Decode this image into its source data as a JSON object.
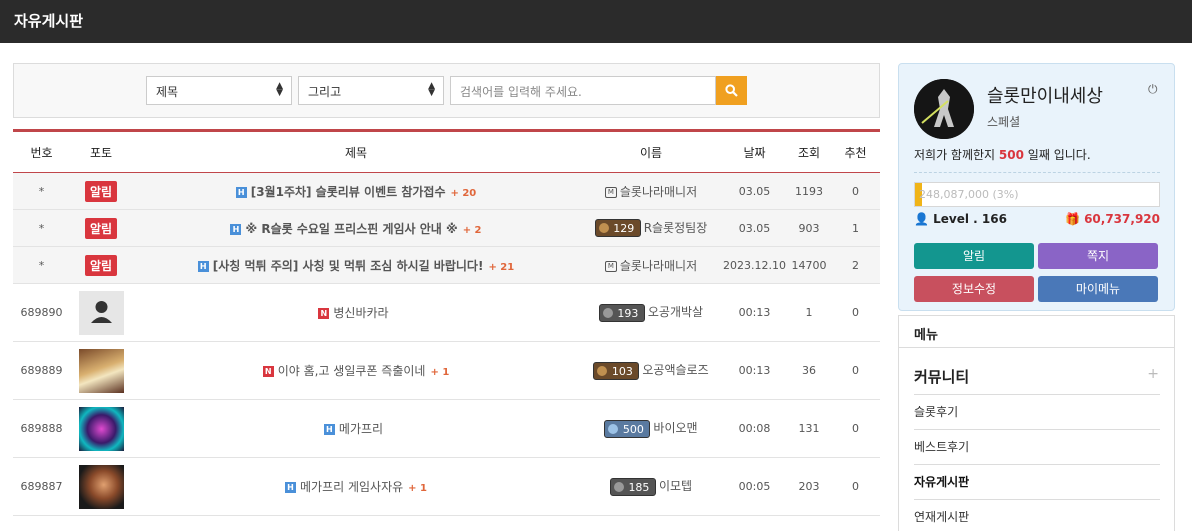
{
  "board_title": "자유게시판",
  "search": {
    "field_select": "제목",
    "operator_select": "그리고",
    "placeholder": "검색어를 입력해 주세요."
  },
  "table": {
    "headers": [
      "번호",
      "포토",
      "제목",
      "이름",
      "날짜",
      "조회",
      "추천"
    ],
    "notices": [
      {
        "num": "*",
        "badge": "알림",
        "title": "[3월1주차] 슬롯리뷰 이벤트 참가접수",
        "comments": "+ 20",
        "name": "슬롯나라매니저",
        "level": "",
        "date": "03.05",
        "views": "1193",
        "likes": "0"
      },
      {
        "num": "*",
        "badge": "알림",
        "title": "※ R슬롯 수요일 프리스핀 게임사 안내 ※",
        "comments": "+ 2",
        "name": "R슬롯정팀장",
        "level": "129",
        "date": "03.05",
        "views": "903",
        "likes": "1"
      },
      {
        "num": "*",
        "badge": "알림",
        "title": "[사칭 먹튀 주의] 사칭 및 먹튀 조심 하시길 바랍니다!",
        "comments": "+ 21",
        "name": "슬롯나라매니저",
        "level": "",
        "date": "2023.12.10",
        "views": "14700",
        "likes": "2"
      }
    ],
    "posts": [
      {
        "num": "689890",
        "title": "병신바카라",
        "comments": "",
        "name": "오공개박살",
        "level": "193",
        "date": "00:13",
        "views": "1",
        "likes": "0",
        "photo": "default-avatar"
      },
      {
        "num": "689889",
        "title": "이야 홈,고 생일쿠폰 즉출이네",
        "comments": "+ 1",
        "name": "오공액슬로즈",
        "level": "103",
        "date": "00:13",
        "views": "36",
        "likes": "0",
        "photo": "beer"
      },
      {
        "num": "689888",
        "title": "메가프리",
        "comments": "",
        "name": "바이오맨",
        "level": "500",
        "date": "00:08",
        "views": "131",
        "likes": "0",
        "photo": "neon"
      },
      {
        "num": "689887",
        "title": "메가프리 게임사자유",
        "comments": "+ 1",
        "name": "이모텝",
        "level": "185",
        "date": "00:05",
        "views": "203",
        "likes": "0",
        "photo": "face"
      }
    ]
  },
  "profile": {
    "username": "슬롯만이내세상",
    "role": "스페셜",
    "days_prefix": "저희가 함께한지 ",
    "days": "500",
    "days_suffix": " 일째 입니다.",
    "xp_text": "248,087,000 (3%)",
    "xp_fraction": 0.03,
    "level_text": "Level . 166",
    "points": "60,737,920",
    "buttons": {
      "alarm": "알림",
      "message": "쪽지",
      "edit": "정보수정",
      "mymenu": "마이메뉴"
    }
  },
  "menu": {
    "header": "메뉴",
    "category": "커뮤니티",
    "plus": "+",
    "items": [
      "슬롯후기",
      "베스트후기",
      "자유게시판",
      "연재게시판"
    ]
  },
  "colors": {
    "accent_red": "#d9363e",
    "search_button": "#f0a020",
    "btn_teal": "#13968f",
    "btn_purple": "#8a64c6",
    "btn_rose": "#c8505e",
    "btn_blue": "#4a78b8"
  }
}
